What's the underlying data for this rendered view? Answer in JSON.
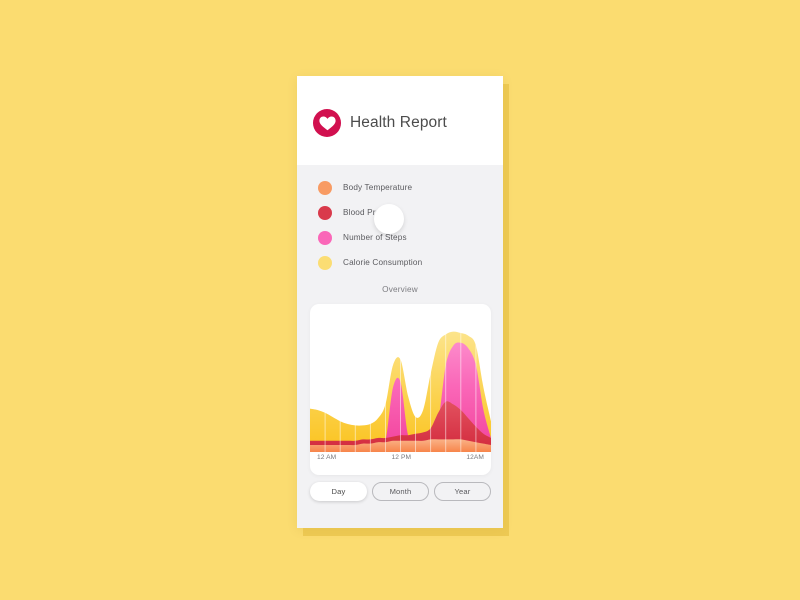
{
  "page": {
    "background_color": "#FBDC70"
  },
  "header": {
    "title": "Health Report",
    "logo_icon": "heart-icon",
    "logo_color": "#D1104F",
    "home_indicator": "home-circle"
  },
  "legend": {
    "items": [
      {
        "label": "Body Temperature",
        "color": "#F89B63"
      },
      {
        "label": "Blood Pressure",
        "color": "#D93A4B"
      },
      {
        "label": "Number of Steps",
        "color": "#FA67B8"
      },
      {
        "label": "Calorie Consumption",
        "color": "#FBDD73"
      }
    ]
  },
  "overview": {
    "title": "Overview"
  },
  "range_selector": {
    "options": [
      {
        "label": "Day",
        "selected": true
      },
      {
        "label": "Month",
        "selected": false
      },
      {
        "label": "Year",
        "selected": false
      }
    ]
  },
  "chart_data": {
    "type": "area",
    "title": "Overview",
    "xlabel": "",
    "ylabel": "",
    "grid": true,
    "grid_orientation": "vertical",
    "grid_count": 11,
    "legend_position": "above-chart",
    "x": [
      0,
      1,
      2,
      3,
      4,
      5,
      6,
      7,
      8,
      9,
      10,
      11,
      12,
      13,
      14,
      15,
      16,
      17,
      18,
      19,
      20,
      21,
      22,
      23,
      24
    ],
    "xlim": [
      0,
      24
    ],
    "ylim": [
      0,
      100
    ],
    "tick_labels": [
      "12 AM",
      "12 PM",
      "12AM"
    ],
    "tick_positions": [
      0,
      12,
      24
    ],
    "series": [
      {
        "name": "Calorie Consumption",
        "color": "#FBDD73",
        "gradient_from": "#FBC52A",
        "gradient_to": "#FCE489",
        "values": [
          31,
          30,
          28,
          25,
          22,
          20,
          19,
          19,
          20,
          24,
          34,
          62,
          66,
          40,
          25,
          30,
          56,
          78,
          84,
          86,
          85,
          83,
          76,
          46,
          22
        ]
      },
      {
        "name": "Number of Steps",
        "color": "#FA67B8",
        "gradient_from": "#F3479F",
        "gradient_to": "#FC86C8",
        "values": [
          7,
          7,
          6,
          6,
          5,
          5,
          5,
          5,
          5,
          6,
          8,
          46,
          50,
          12,
          7,
          7,
          10,
          22,
          62,
          76,
          78,
          74,
          62,
          30,
          10
        ]
      },
      {
        "name": "Blood Pressure",
        "color": "#D93A4B",
        "gradient_from": "#CE2B3D",
        "gradient_to": "#E05464",
        "values": [
          8,
          8,
          8,
          8,
          8,
          8,
          8,
          9,
          9,
          10,
          10,
          11,
          12,
          12,
          13,
          14,
          17,
          28,
          36,
          34,
          30,
          24,
          18,
          13,
          10
        ]
      },
      {
        "name": "Body Temperature",
        "color": "#F89B63",
        "gradient_from": "#F78A53",
        "gradient_to": "#FAB184",
        "values": [
          5,
          5,
          5,
          5,
          5,
          5,
          5,
          6,
          6,
          7,
          7,
          8,
          8,
          8,
          8,
          8,
          9,
          9,
          9,
          9,
          9,
          8,
          7,
          6,
          5
        ]
      }
    ]
  }
}
